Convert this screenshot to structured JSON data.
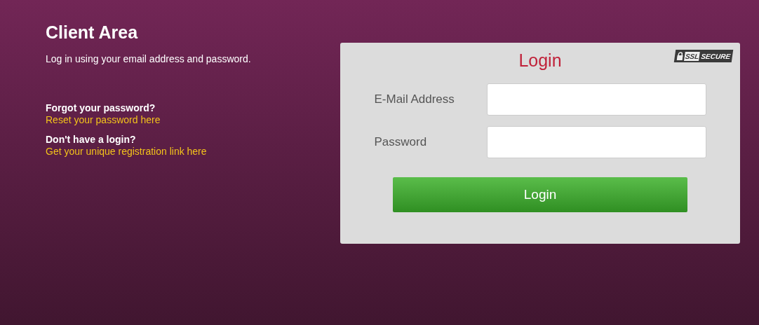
{
  "heading": "Client Area",
  "intro": "Log in using your email address and password.",
  "help": [
    {
      "question": "Forgot your password?",
      "link": "Reset your password here"
    },
    {
      "question": "Don't have a login?",
      "link": "Get your unique registration link here"
    }
  ],
  "login": {
    "title": "Login",
    "badge": {
      "left": "SSL",
      "right": "SECURE"
    },
    "fields": [
      {
        "label": "E-Mail Address"
      },
      {
        "label": "Password"
      }
    ],
    "button": "Login"
  }
}
